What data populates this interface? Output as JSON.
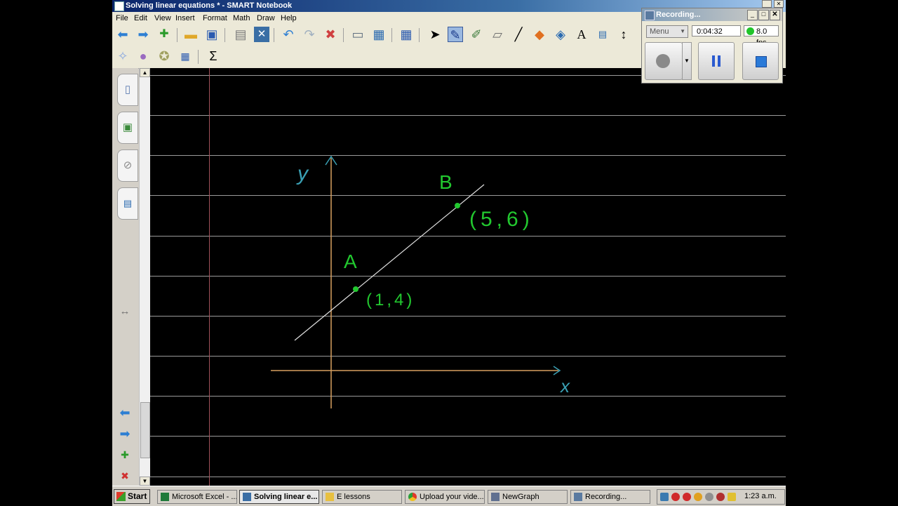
{
  "window": {
    "title": "Solving linear equations * - SMART Notebook"
  },
  "menu": [
    "File",
    "Edit",
    "View",
    "Insert",
    "Format",
    "Math",
    "Draw",
    "Help"
  ],
  "canvas": {
    "axis_y_label": "y",
    "axis_x_label": "x",
    "point_a": {
      "label": "A",
      "coords": "(1,4)"
    },
    "point_b": {
      "label": "B",
      "coords": "(5,6)"
    }
  },
  "recording": {
    "title": "Recording...",
    "menu_label": "Menu",
    "elapsed": "0:04:32",
    "fps": "8.0 fps"
  },
  "taskbar": {
    "start": "Start",
    "tasks": [
      {
        "label": "Microsoft Excel - ...",
        "icon": "excel-icon"
      },
      {
        "label": "Solving linear e...",
        "icon": "notebook-icon",
        "active": true
      },
      {
        "label": "E lessons",
        "icon": "folder-icon"
      },
      {
        "label": "Upload your vide...",
        "icon": "chrome-icon"
      },
      {
        "label": "NewGraph",
        "icon": "graph-icon"
      },
      {
        "label": "Recording...",
        "icon": "recorder-icon"
      }
    ],
    "clock": "1:23 a.m."
  },
  "colors": {
    "title_bar": "#0a246a",
    "ink_green": "#22c82f",
    "ink_blue": "#3aa0b4",
    "axis_orange": "#d8a060",
    "line_white": "#e0e0e0",
    "rec_green": "#21c42a"
  }
}
